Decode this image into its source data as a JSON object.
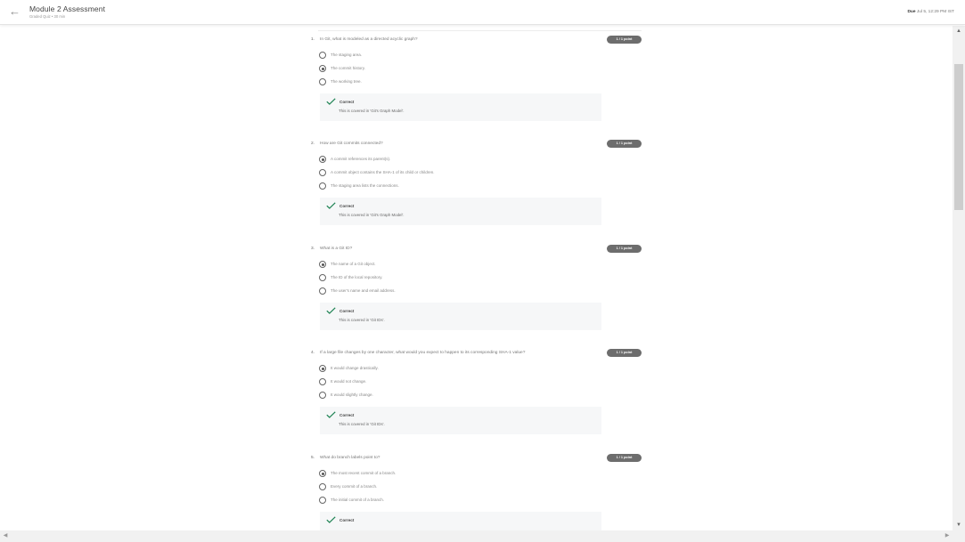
{
  "header": {
    "back_icon": "arrow-left-icon",
    "title": "Module 2 Assessment",
    "subtitle": "Graded Quiz • 30 min",
    "due_label": "Due",
    "due_value": "Jul 5, 12:29 PM IST"
  },
  "questions": [
    {
      "number": "1.",
      "text": "In Git, what is modeled as a directed acyclic graph?",
      "points": "1 / 1 point",
      "options": [
        {
          "label": "The staging area.",
          "selected": false
        },
        {
          "label": "The commit history.",
          "selected": true
        },
        {
          "label": "The working tree.",
          "selected": false
        }
      ],
      "feedback": {
        "status": "Correct",
        "text": "This is covered in 'Git's Graph Model'."
      }
    },
    {
      "number": "2.",
      "text": "How are Git commits connected?",
      "points": "1 / 1 point",
      "options": [
        {
          "label": "A commit references its parent(s).",
          "selected": true
        },
        {
          "label": "A commit object contains the SHA-1 of its child or children.",
          "selected": false
        },
        {
          "label": "The staging area lists the connections.",
          "selected": false
        }
      ],
      "feedback": {
        "status": "Correct",
        "text": "This is covered in 'Git's Graph Model'."
      }
    },
    {
      "number": "3.",
      "text": "What is a Git ID?",
      "points": "1 / 1 point",
      "options": [
        {
          "label": "The name of a Git object.",
          "selected": true
        },
        {
          "label": "The ID of the local repository.",
          "selected": false
        },
        {
          "label": "The user's name and email address.",
          "selected": false
        }
      ],
      "feedback": {
        "status": "Correct",
        "text": "This is covered in 'Git IDs'."
      }
    },
    {
      "number": "4.",
      "text": "If a large file changes by one character, what would you expect to happen to its corresponding SHA-1 value?",
      "points": "1 / 1 point",
      "options": [
        {
          "label": "It would change drastically.",
          "selected": true
        },
        {
          "label": "It would not change.",
          "selected": false
        },
        {
          "label": "It would slightly change.",
          "selected": false
        }
      ],
      "feedback": {
        "status": "Correct",
        "text": "This is covered in 'Git IDs'."
      }
    },
    {
      "number": "5.",
      "text": "What do branch labels point to?",
      "points": "1 / 1 point",
      "options": [
        {
          "label": "The most recent commit of a branch.",
          "selected": true
        },
        {
          "label": "Every commit of a branch.",
          "selected": false
        },
        {
          "label": "The initial commit of a branch.",
          "selected": false
        }
      ],
      "feedback": {
        "status": "Correct",
        "text": ""
      }
    }
  ],
  "scrollbar": {
    "up_icon": "caret-up-icon",
    "down_icon": "caret-down-icon",
    "left_icon": "caret-left-icon",
    "right_icon": "caret-right-icon"
  },
  "colors": {
    "badge": "#6d6d6d",
    "check": "#1f8354",
    "feedback_bg": "#f6f7f8"
  }
}
